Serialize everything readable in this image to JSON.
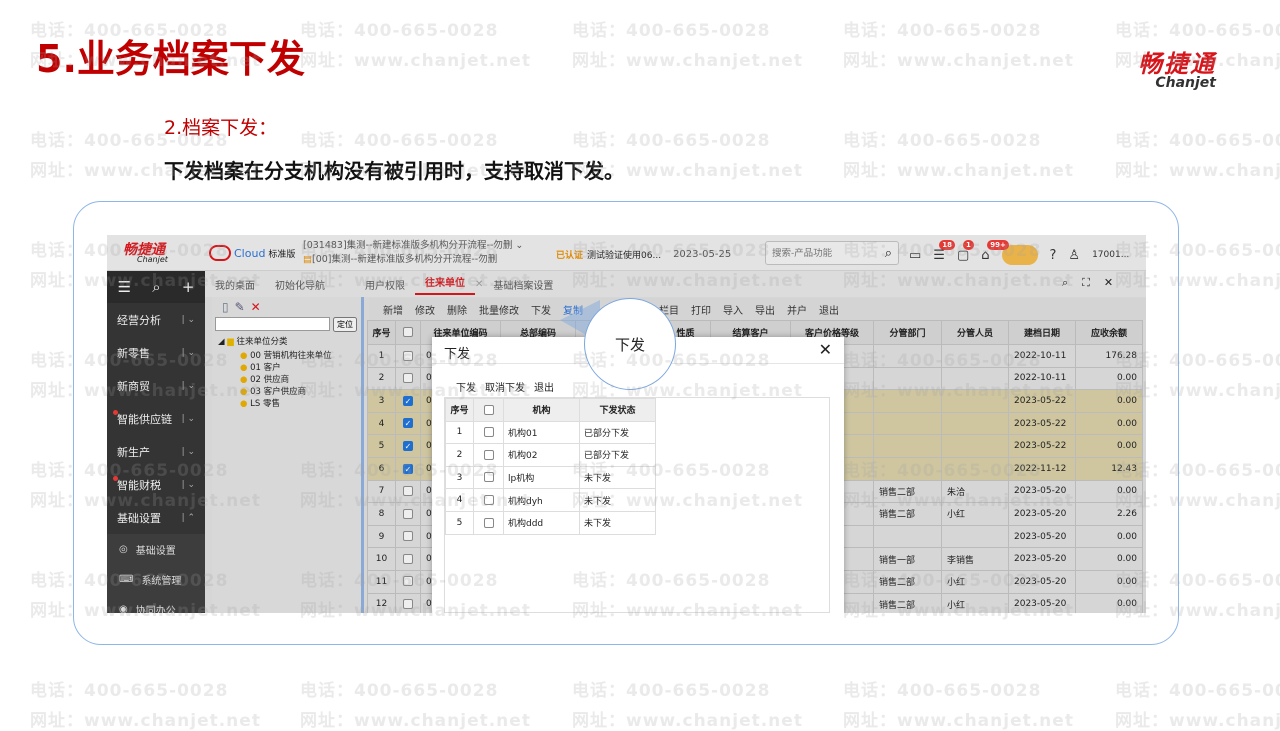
{
  "watermark": {
    "phone": "电话：400-665-0028",
    "site": "网址：www.chanjet.net"
  },
  "slide": {
    "title": "5.业务档案下发",
    "logo_cn": "畅捷通",
    "logo_en": "Chanjet",
    "subtitle": "2.档案下发：",
    "description": "下发档案在分支机构没有被引用时，支持取消下发。"
  },
  "app": {
    "brand_cn": "畅捷通",
    "brand_en": "Chanjet",
    "cloud": "Cloud",
    "edition": "标准版",
    "account_line1": "[031483]集测--新建标准版多机构分开流程--勿删",
    "account_line2": "[00]集测--新建标准版多机构分开流程--勿删",
    "verified": "已认证",
    "verify_text": "测试验证使用06...",
    "date": "2023-05-25",
    "search_placeholder": "搜索-产品功能",
    "badges": [
      "18",
      "1",
      "99+"
    ],
    "user": "17001...",
    "sidebar": [
      {
        "label": "经营分析",
        "dot": false
      },
      {
        "label": "新零售",
        "dot": false
      },
      {
        "label": "新商贸",
        "dot": false
      },
      {
        "label": "智能供应链",
        "dot": true
      },
      {
        "label": "新生产",
        "dot": false
      },
      {
        "label": "智能财税",
        "dot": true
      },
      {
        "label": "基础设置",
        "dot": false,
        "open": true
      }
    ],
    "sidebar_sub": [
      "基础设置",
      "系统管理",
      "协同办公"
    ],
    "tabs": [
      "我的桌面",
      "初始化导航",
      "用户权限",
      "往来单位",
      "基础档案设置"
    ],
    "tree": {
      "locate": "定位",
      "root": "往来单位分类",
      "children": [
        "00 营销机构往来单位",
        "01 客户",
        "02 供应商",
        "03 客户供应商",
        "LS 零售"
      ]
    },
    "toolbar": [
      "新增",
      "修改",
      "删除",
      "批量修改",
      "下发",
      "复制",
      "栏目",
      "打印",
      "导入",
      "导出",
      "并户",
      "退出"
    ],
    "columns": [
      "序号",
      "",
      "往来单位编码",
      "总部编码",
      "",
      "性质",
      "结算客户",
      "客户价格等级",
      "分管部门",
      "分管人员",
      "建档日期",
      "应收余额"
    ],
    "rows": [
      {
        "no": "1",
        "checked": false,
        "code": "0",
        "dept": "",
        "person": "",
        "date": "2022-10-11",
        "bal": "176.28"
      },
      {
        "no": "2",
        "checked": false,
        "code": "0",
        "dept": "",
        "person": "",
        "date": "2022-10-11",
        "bal": "0.00"
      },
      {
        "no": "3",
        "checked": true,
        "code": "0",
        "dept": "",
        "person": "",
        "date": "2023-05-22",
        "bal": "0.00"
      },
      {
        "no": "4",
        "checked": true,
        "code": "0",
        "dept": "",
        "person": "",
        "date": "2023-05-22",
        "bal": "0.00"
      },
      {
        "no": "5",
        "checked": true,
        "code": "0",
        "dept": "",
        "person": "",
        "date": "2023-05-22",
        "bal": "0.00"
      },
      {
        "no": "6",
        "checked": true,
        "code": "0",
        "dept": "",
        "person": "",
        "date": "2022-11-12",
        "bal": "12.43"
      },
      {
        "no": "7",
        "checked": false,
        "code": "0",
        "dept": "销售二部",
        "person": "朱洽",
        "date": "2023-05-20",
        "bal": "0.00"
      },
      {
        "no": "8",
        "checked": false,
        "code": "0",
        "dept": "销售二部",
        "person": "小红",
        "date": "2023-05-20",
        "bal": "2.26"
      },
      {
        "no": "9",
        "checked": false,
        "code": "0",
        "dept": "",
        "person": "",
        "date": "2023-05-20",
        "bal": "0.00"
      },
      {
        "no": "10",
        "checked": false,
        "code": "0",
        "dept": "销售一部",
        "person": "李销售",
        "date": "2023-05-20",
        "bal": "0.00"
      },
      {
        "no": "11",
        "checked": false,
        "code": "0",
        "dept": "销售二部",
        "person": "小红",
        "date": "2023-05-20",
        "bal": "0.00"
      },
      {
        "no": "12",
        "checked": false,
        "code": "0",
        "dept": "销售二部",
        "person": "小红",
        "date": "2023-05-20",
        "bal": "0.00"
      }
    ]
  },
  "dialog": {
    "title": "下发",
    "actions": [
      "下发",
      "取消下发",
      "退出"
    ],
    "columns": [
      "序号",
      "",
      "机构",
      "下发状态"
    ],
    "rows": [
      {
        "no": "1",
        "org": "机构01",
        "status": "已部分下发"
      },
      {
        "no": "2",
        "org": "机构02",
        "status": "已部分下发"
      },
      {
        "no": "3",
        "org": "lp机构",
        "status": "未下发"
      },
      {
        "no": "4",
        "org": "机构dyh",
        "status": "未下发"
      },
      {
        "no": "5",
        "org": "机构ddd",
        "status": "未下发"
      }
    ]
  },
  "callout": "下发"
}
